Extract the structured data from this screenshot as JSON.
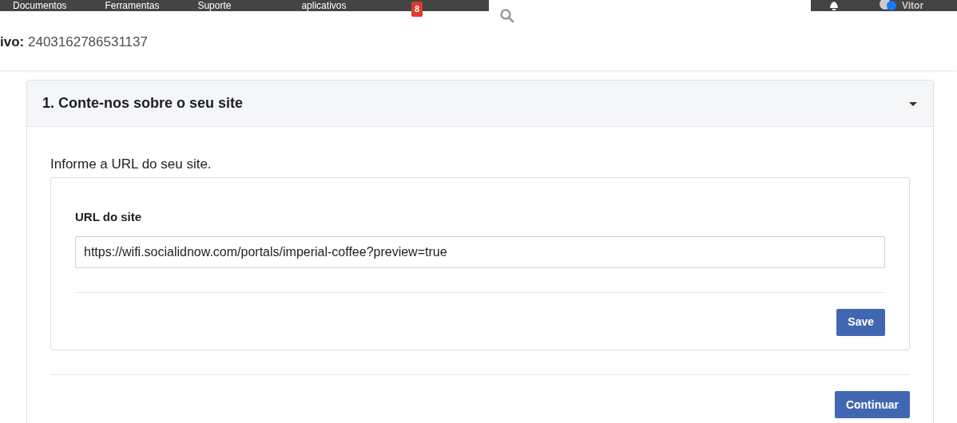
{
  "top_nav": {
    "items": [
      "Documentos",
      "Ferramentas",
      "Suporte",
      "aplicativos"
    ],
    "badge": "8",
    "user": "Vitor"
  },
  "app_id": {
    "label": "ivo:",
    "value": "2403162786531137"
  },
  "section": {
    "title": "1. Conte-nos sobre o seu site",
    "expanded": true,
    "prompt": "Informe a URL do seu site.",
    "field_label": "URL do site",
    "url_value": "https://wifi.socialidnow.com/portals/imperial-coffee?preview=true",
    "save_button": "Save"
  },
  "continue_button": "Continuar"
}
